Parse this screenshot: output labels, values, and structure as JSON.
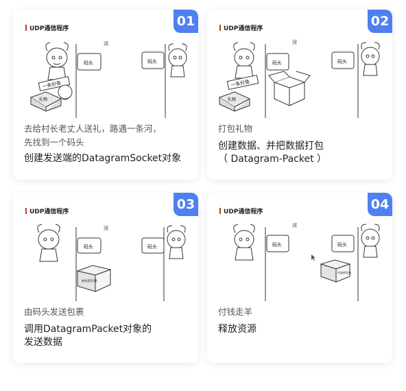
{
  "cards": [
    {
      "badge": "01",
      "scene_title": "UDP通信程序",
      "river": "河",
      "dock_left": "码头",
      "dock_right": "码头",
      "sub_lines": [
        "去给村长老丈人送礼，路遇一条河，",
        "先找到一个码头"
      ],
      "main_lines": [
        "创建发送端的DatagramSocket对象"
      ],
      "sign": "一条好鱼",
      "gift": "礼物"
    },
    {
      "badge": "02",
      "scene_title": "UDP通信程序",
      "river": "河",
      "dock_left": "码头",
      "dock_right": "码头",
      "sub_lines": [
        "打包礼物"
      ],
      "main_lines": [
        "创建数据、并把数据打包",
        "（ Datagram-Packet ）"
      ],
      "sign": "一条好鱼",
      "gift": "礼物"
    },
    {
      "badge": "03",
      "scene_title": "UDP通信程序",
      "river": "河",
      "dock_left": "码头",
      "dock_right": "码头",
      "sub_lines": [
        "由码头发送包裹"
      ],
      "main_lines": [
        "调用DatagramPacket对象的",
        "发送数据"
      ],
      "box_label": "村长的礼物"
    },
    {
      "badge": "04",
      "scene_title": "UDP通信程序",
      "river": "河",
      "dock_left": "码头",
      "dock_right": "码头",
      "sub_lines": [
        "付钱走羊"
      ],
      "main_lines": [
        "释放资源"
      ],
      "box_label": "村长的礼物"
    }
  ]
}
